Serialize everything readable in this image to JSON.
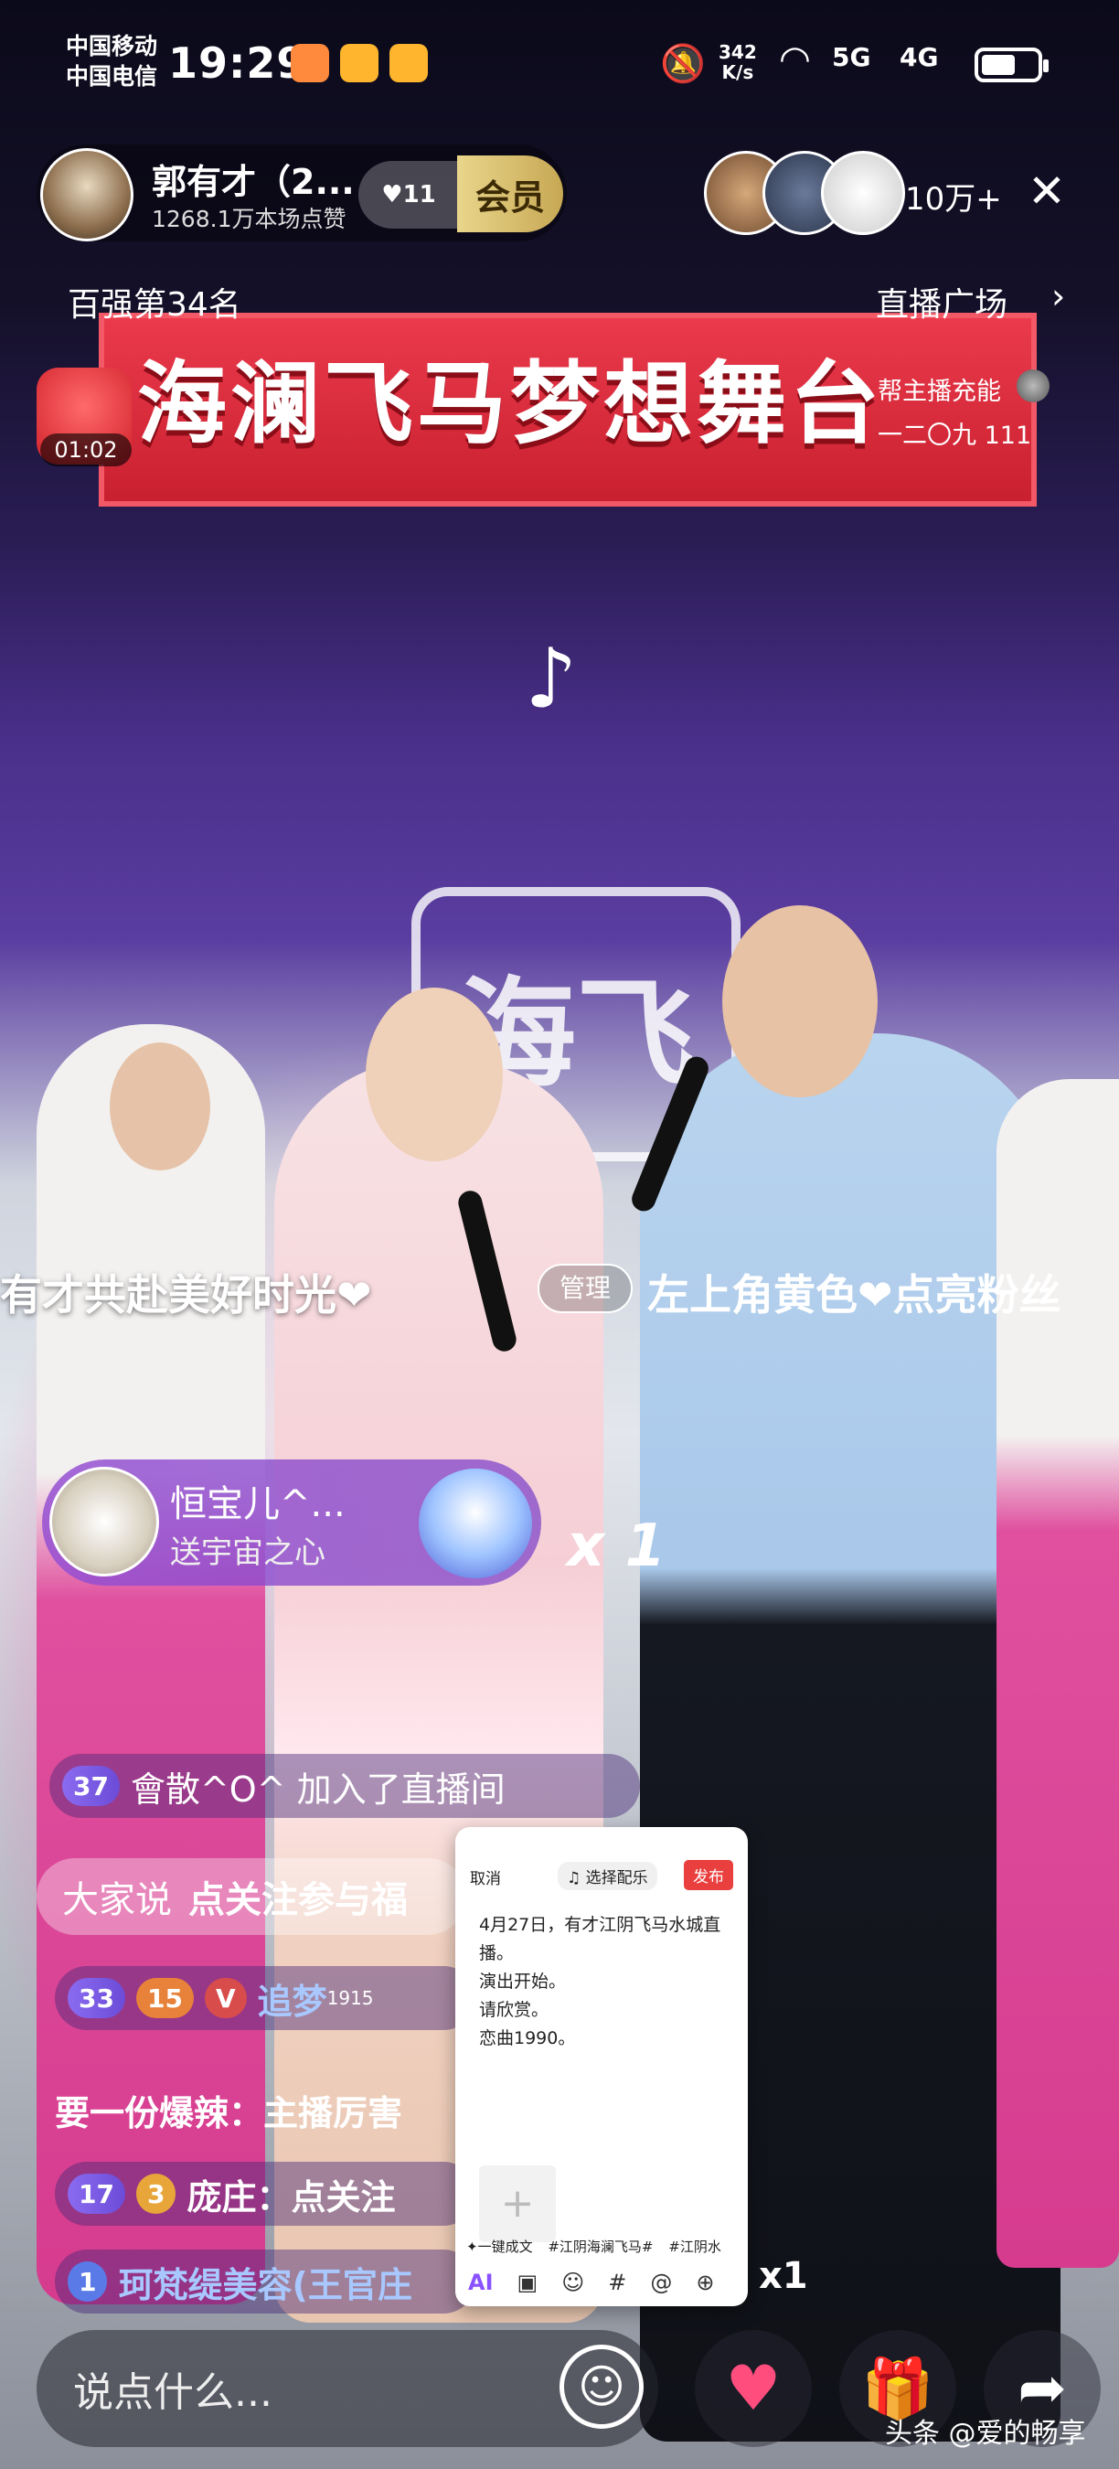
{
  "status_bar": {
    "carrier1": "中国移动",
    "carrier2": "中国电信",
    "time": "19:29",
    "speed_value": "342",
    "speed_unit": "K/s",
    "net1": "5G",
    "net2": "4G"
  },
  "header": {
    "streamer_name": "郭有才（2...",
    "likes_text": "1268.1万本场点赞",
    "heart_level": "11",
    "member_label": "会员",
    "viewer_count": "10万+",
    "close_icon": "close-icon",
    "rank_text": "百强第34名",
    "plaza_text": "直播广场",
    "plaza_arrow": "›",
    "redbag_timer": "01:02",
    "recharge_text": "帮主播充能",
    "recharge_sub": "一二〇九 111"
  },
  "stage": {
    "banner_text": "海澜飞马梦想舞台",
    "sign_text": "海飞",
    "tiktok_logo": "♪"
  },
  "chat": {
    "scroll_left": "有才共赴美好时光❤",
    "admin_badge": "管理",
    "scroll_right": "左上角黄色❤点亮粉丝",
    "gift_user": "恒宝儿^...",
    "gift_action": "送宇宙之心",
    "gift_count": "x 1",
    "join_level": "37",
    "join_text": "會散^O^ 加入了直播间",
    "say_label": "大家说",
    "say_text": "点关注参与福",
    "row33_level": "33",
    "row33_badge": "15",
    "row33_user": "追梦",
    "row33_sup": "1915",
    "spicy_text": "要一份爆辣：主播厉害",
    "row17_level": "17",
    "row17_badge": "3",
    "row17_text": "庞庄：点关注",
    "row1_level": "1",
    "row1_text": "珂梵缇美容(王官庄",
    "row1_count": "x1"
  },
  "compose_popup": {
    "cancel": "取消",
    "music": "♫ 选择配乐",
    "publish": "发布",
    "body_lines": [
      "4月27日，有才江阴飞马水城直播。",
      "演出开始。",
      "请欣赏。",
      "恋曲1990。"
    ],
    "tags": [
      "✦一键成文",
      "#江阴海澜飞马#",
      "#江阴水"
    ],
    "tools": [
      "AI",
      "▣",
      "☺",
      "#",
      "@",
      "⊕"
    ]
  },
  "bottom_bar": {
    "input_placeholder": "说点什么...",
    "emoji_icon": "☺",
    "like_icon": "♥",
    "gift_icon": "🎁",
    "share_icon": "➦"
  },
  "watermark": "头条 @爱的畅享",
  "colors": {
    "accent_red": "#e9403f",
    "member_gold": "#e9d58b",
    "chat_purple": "#6c4cd7"
  }
}
